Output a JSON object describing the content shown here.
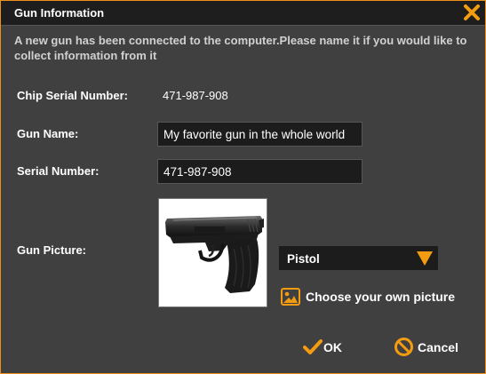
{
  "dialog": {
    "title": "Gun Information",
    "close_icon": "close-x-icon",
    "intro_text": "A new gun has been connected to the computer.Please name it if you would like to collect information from it"
  },
  "form": {
    "chip_serial_label": "Chip Serial Number:",
    "chip_serial_value": "471-987-908",
    "gun_name_label": "Gun Name:",
    "gun_name_value": "My favorite gun in the whole world",
    "serial_number_label": "Serial Number:",
    "serial_number_value": "471-987-908",
    "gun_picture_label": "Gun Picture:",
    "picture_type_selected": "Pistol",
    "choose_picture_label": "Choose your own picture",
    "choose_picture_icon": "image-icon"
  },
  "buttons": {
    "ok_label": "OK",
    "ok_icon": "checkmark-icon",
    "cancel_label": "Cancel",
    "cancel_icon": "prohibit-icon"
  },
  "colors": {
    "accent": "#f39c12",
    "background": "#404040",
    "titlebar": "#1e1e1e",
    "field": "#1c1c1c"
  }
}
